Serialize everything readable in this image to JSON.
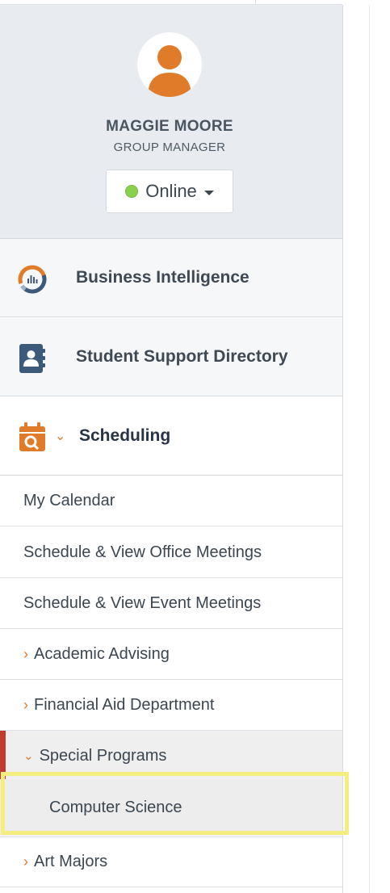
{
  "profile": {
    "name": "MAGGIE MOORE",
    "role": "GROUP MANAGER",
    "status": "Online",
    "status_color": "#8ad04f",
    "avatar_icon": "user-avatar-icon"
  },
  "nav": {
    "business_intelligence": {
      "label": "Business Intelligence",
      "icon": "analytics-donut-icon"
    },
    "student_support": {
      "label": "Student Support Directory",
      "icon": "contact-book-icon"
    },
    "scheduling": {
      "label": "Scheduling",
      "icon": "calendar-search-icon",
      "expanded": true
    }
  },
  "scheduling_items": {
    "my_calendar": "My Calendar",
    "office_meetings": "Schedule & View Office Meetings",
    "event_meetings": "Schedule & View Event Meetings",
    "academic_advising": "Academic Advising",
    "financial_aid": "Financial Aid Department",
    "special_programs": "Special Programs",
    "computer_science": "Computer Science",
    "art_majors": "Art Majors"
  },
  "glyphs": {
    "chevron_right": "›",
    "chevron_down": "⌄"
  },
  "colors": {
    "accent_orange": "#e07b2a",
    "icon_blue": "#3d5a7a",
    "active_bar": "#c23b2e",
    "highlight": "#f4ee7e"
  }
}
